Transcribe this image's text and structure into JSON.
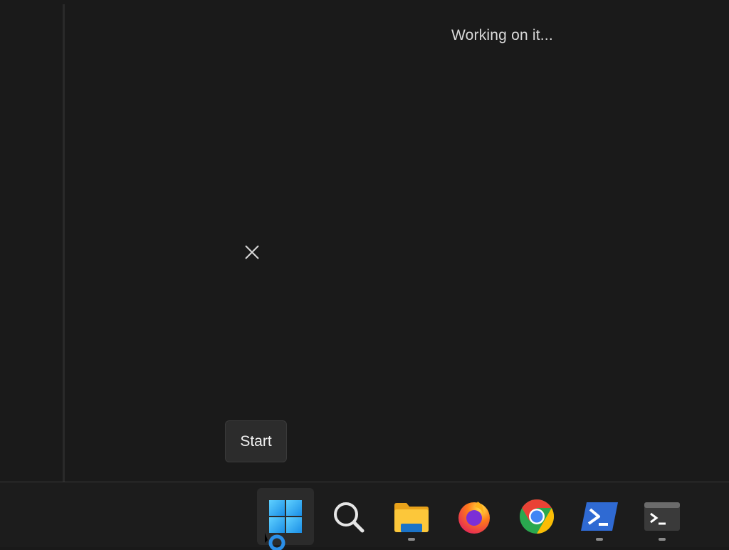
{
  "status": {
    "text": "Working on it..."
  },
  "tooltip": {
    "text": "Start"
  },
  "taskbar": {
    "items": [
      {
        "name": "start-button",
        "icon": "windows-logo-icon",
        "active": true
      },
      {
        "name": "search-button",
        "icon": "search-icon"
      },
      {
        "name": "file-explorer-button",
        "icon": "folder-icon",
        "running": true
      },
      {
        "name": "firefox-button",
        "icon": "firefox-icon"
      },
      {
        "name": "chrome-button",
        "icon": "chrome-icon"
      },
      {
        "name": "powershell-button",
        "icon": "powershell-icon",
        "running": true
      },
      {
        "name": "terminal-button",
        "icon": "terminal-icon",
        "running": true
      }
    ]
  },
  "colors": {
    "background": "#1a1a1a",
    "taskbar": "#1c1c1c",
    "accent": "#2b8fe8"
  }
}
